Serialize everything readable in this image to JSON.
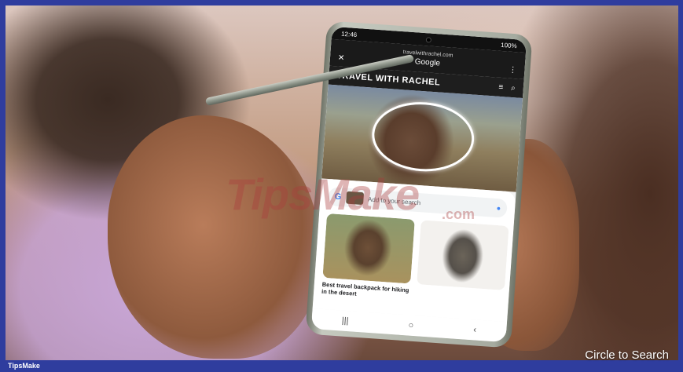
{
  "phone": {
    "status_time": "12:46",
    "status_right": "100%",
    "url": "travelwithrachel.com",
    "search_engine": "Google",
    "site_title": "TRAVEL WITH RACHEL",
    "close_symbol": "✕",
    "more_symbol": "⋮",
    "search_placeholder": "Add to your search",
    "results": [
      {
        "caption": "Best travel backpack for hiking in the desert"
      },
      {
        "caption": ""
      }
    ],
    "nav": {
      "recents": "|||",
      "home": "○",
      "back": "‹"
    }
  },
  "caption": "Circle to Search",
  "footer_label": "TipsMake",
  "watermark": "TipsMake",
  "watermark_suffix": ".com",
  "colors": {
    "frame": "#2f3d9e",
    "circle": "#ffffff"
  }
}
